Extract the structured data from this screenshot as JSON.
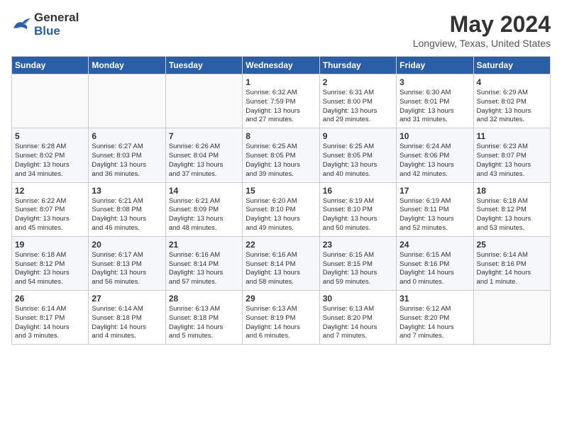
{
  "header": {
    "logo_line1": "General",
    "logo_line2": "Blue",
    "month": "May 2024",
    "location": "Longview, Texas, United States"
  },
  "weekdays": [
    "Sunday",
    "Monday",
    "Tuesday",
    "Wednesday",
    "Thursday",
    "Friday",
    "Saturday"
  ],
  "weeks": [
    [
      {
        "day": "",
        "info": ""
      },
      {
        "day": "",
        "info": ""
      },
      {
        "day": "",
        "info": ""
      },
      {
        "day": "1",
        "info": "Sunrise: 6:32 AM\nSunset: 7:59 PM\nDaylight: 13 hours\nand 27 minutes."
      },
      {
        "day": "2",
        "info": "Sunrise: 6:31 AM\nSunset: 8:00 PM\nDaylight: 13 hours\nand 29 minutes."
      },
      {
        "day": "3",
        "info": "Sunrise: 6:30 AM\nSunset: 8:01 PM\nDaylight: 13 hours\nand 31 minutes."
      },
      {
        "day": "4",
        "info": "Sunrise: 6:29 AM\nSunset: 8:02 PM\nDaylight: 13 hours\nand 32 minutes."
      }
    ],
    [
      {
        "day": "5",
        "info": "Sunrise: 6:28 AM\nSunset: 8:02 PM\nDaylight: 13 hours\nand 34 minutes."
      },
      {
        "day": "6",
        "info": "Sunrise: 6:27 AM\nSunset: 8:03 PM\nDaylight: 13 hours\nand 36 minutes."
      },
      {
        "day": "7",
        "info": "Sunrise: 6:26 AM\nSunset: 8:04 PM\nDaylight: 13 hours\nand 37 minutes."
      },
      {
        "day": "8",
        "info": "Sunrise: 6:25 AM\nSunset: 8:05 PM\nDaylight: 13 hours\nand 39 minutes."
      },
      {
        "day": "9",
        "info": "Sunrise: 6:25 AM\nSunset: 8:05 PM\nDaylight: 13 hours\nand 40 minutes."
      },
      {
        "day": "10",
        "info": "Sunrise: 6:24 AM\nSunset: 8:06 PM\nDaylight: 13 hours\nand 42 minutes."
      },
      {
        "day": "11",
        "info": "Sunrise: 6:23 AM\nSunset: 8:07 PM\nDaylight: 13 hours\nand 43 minutes."
      }
    ],
    [
      {
        "day": "12",
        "info": "Sunrise: 6:22 AM\nSunset: 8:07 PM\nDaylight: 13 hours\nand 45 minutes."
      },
      {
        "day": "13",
        "info": "Sunrise: 6:21 AM\nSunset: 8:08 PM\nDaylight: 13 hours\nand 46 minutes."
      },
      {
        "day": "14",
        "info": "Sunrise: 6:21 AM\nSunset: 8:09 PM\nDaylight: 13 hours\nand 48 minutes."
      },
      {
        "day": "15",
        "info": "Sunrise: 6:20 AM\nSunset: 8:10 PM\nDaylight: 13 hours\nand 49 minutes."
      },
      {
        "day": "16",
        "info": "Sunrise: 6:19 AM\nSunset: 8:10 PM\nDaylight: 13 hours\nand 50 minutes."
      },
      {
        "day": "17",
        "info": "Sunrise: 6:19 AM\nSunset: 8:11 PM\nDaylight: 13 hours\nand 52 minutes."
      },
      {
        "day": "18",
        "info": "Sunrise: 6:18 AM\nSunset: 8:12 PM\nDaylight: 13 hours\nand 53 minutes."
      }
    ],
    [
      {
        "day": "19",
        "info": "Sunrise: 6:18 AM\nSunset: 8:12 PM\nDaylight: 13 hours\nand 54 minutes."
      },
      {
        "day": "20",
        "info": "Sunrise: 6:17 AM\nSunset: 8:13 PM\nDaylight: 13 hours\nand 56 minutes."
      },
      {
        "day": "21",
        "info": "Sunrise: 6:16 AM\nSunset: 8:14 PM\nDaylight: 13 hours\nand 57 minutes."
      },
      {
        "day": "22",
        "info": "Sunrise: 6:16 AM\nSunset: 8:14 PM\nDaylight: 13 hours\nand 58 minutes."
      },
      {
        "day": "23",
        "info": "Sunrise: 6:15 AM\nSunset: 8:15 PM\nDaylight: 13 hours\nand 59 minutes."
      },
      {
        "day": "24",
        "info": "Sunrise: 6:15 AM\nSunset: 8:16 PM\nDaylight: 14 hours\nand 0 minutes."
      },
      {
        "day": "25",
        "info": "Sunrise: 6:14 AM\nSunset: 8:16 PM\nDaylight: 14 hours\nand 1 minute."
      }
    ],
    [
      {
        "day": "26",
        "info": "Sunrise: 6:14 AM\nSunset: 8:17 PM\nDaylight: 14 hours\nand 3 minutes."
      },
      {
        "day": "27",
        "info": "Sunrise: 6:14 AM\nSunset: 8:18 PM\nDaylight: 14 hours\nand 4 minutes."
      },
      {
        "day": "28",
        "info": "Sunrise: 6:13 AM\nSunset: 8:18 PM\nDaylight: 14 hours\nand 5 minutes."
      },
      {
        "day": "29",
        "info": "Sunrise: 6:13 AM\nSunset: 8:19 PM\nDaylight: 14 hours\nand 6 minutes."
      },
      {
        "day": "30",
        "info": "Sunrise: 6:13 AM\nSunset: 8:20 PM\nDaylight: 14 hours\nand 7 minutes."
      },
      {
        "day": "31",
        "info": "Sunrise: 6:12 AM\nSunset: 8:20 PM\nDaylight: 14 hours\nand 7 minutes."
      },
      {
        "day": "",
        "info": ""
      }
    ]
  ]
}
